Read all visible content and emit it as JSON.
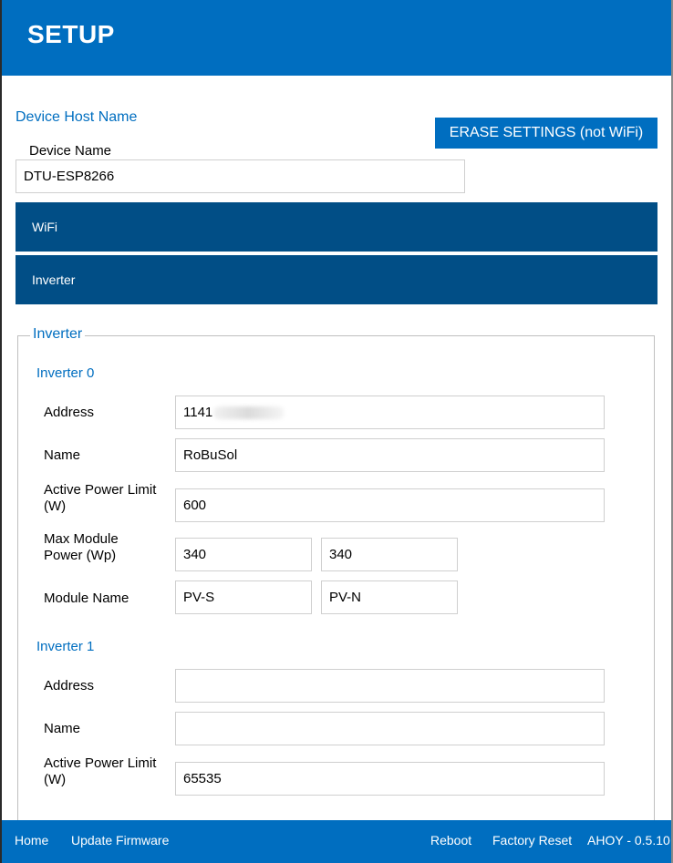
{
  "header": {
    "title": "SETUP"
  },
  "device_host": {
    "section_title": "Device Host Name",
    "erase_label": "ERASE SETTINGS (not WiFi)",
    "device_name_label": "Device Name",
    "device_name_value": "DTU-ESP8266"
  },
  "collapsibles": {
    "wifi": "WiFi",
    "inverter": "Inverter"
  },
  "inverter_fieldset": {
    "legend": "Inverter",
    "inverter0": {
      "title": "Inverter 0",
      "address_label": "Address",
      "address_value": "1141",
      "name_label": "Name",
      "name_value": "RoBuSol",
      "power_limit_label": "Active Power Limit (W)",
      "power_limit_value": "600",
      "max_module_label": "Max Module Power (Wp)",
      "max_module_1": "340",
      "max_module_2": "340",
      "module_name_label": "Module Name",
      "module_name_1": "PV-S",
      "module_name_2": "PV-N"
    },
    "inverter1": {
      "title": "Inverter 1",
      "address_label": "Address",
      "address_value": "",
      "name_label": "Name",
      "name_value": "",
      "power_limit_label": "Active Power Limit (W)",
      "power_limit_value": "65535"
    }
  },
  "footer": {
    "home": "Home",
    "update_firmware": "Update Firmware",
    "reboot": "Reboot",
    "factory_reset": "Factory Reset",
    "version": "AHOY - 0.5.10"
  },
  "colors": {
    "header_bg": "#006ec0",
    "collapsible_bg": "#014e86",
    "accent_text": "#006ec0"
  }
}
